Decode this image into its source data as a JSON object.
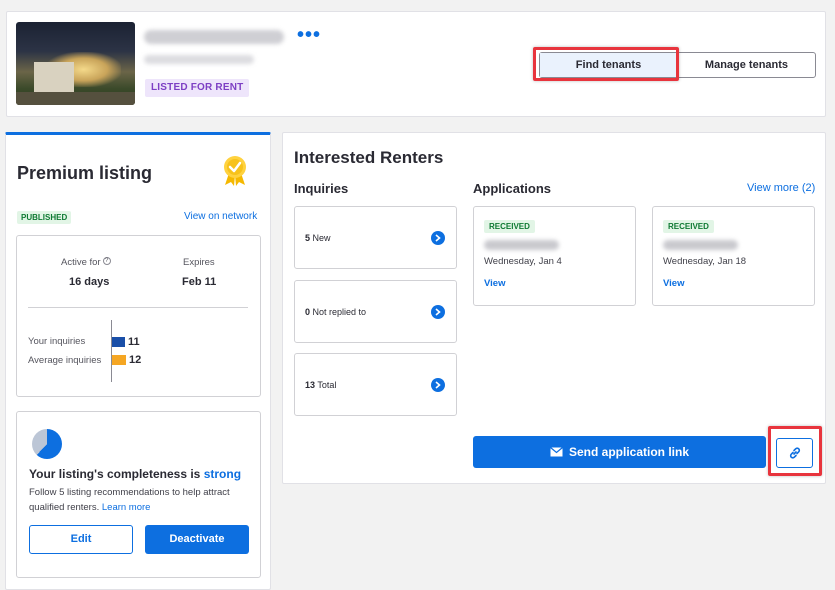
{
  "header": {
    "status_badge": "LISTED FOR RENT",
    "more_icon": "more-horizontal-icon",
    "tabs": [
      {
        "label": "Find tenants",
        "active": true
      },
      {
        "label": "Manage tenants",
        "active": false
      }
    ]
  },
  "premium": {
    "title": "Premium listing",
    "medal_icon": "medal-check-icon",
    "published_badge": "PUBLISHED",
    "view_network": "View on network",
    "active_for_label": "Active for",
    "active_for_value": "16 days",
    "expires_label": "Expires",
    "expires_value": "Feb 11",
    "inquiries": [
      {
        "label": "Your inquiries",
        "value": 11,
        "color": "#1a4fa8"
      },
      {
        "label": "Average inquiries",
        "value": 12,
        "color": "#f5a623"
      }
    ],
    "completeness": {
      "head_prefix": "Your listing's completeness is",
      "level": "strong",
      "fill": 0.62,
      "sub": "Follow 5 listing recommendations to help attract qualified renters.",
      "learn_more": "Learn more",
      "edit_label": "Edit",
      "deactivate_label": "Deactivate"
    }
  },
  "renters": {
    "title": "Interested Renters",
    "inquiries_title": "Inquiries",
    "inquiries": [
      {
        "count": "5",
        "label": "New"
      },
      {
        "count": "0",
        "label": "Not replied to"
      },
      {
        "count": "13",
        "label": "Total"
      }
    ],
    "applications_title": "Applications",
    "view_more": "View more (2)",
    "applications": [
      {
        "badge": "RECEIVED",
        "date": "Wednesday, Jan 4",
        "view": "View"
      },
      {
        "badge": "RECEIVED",
        "date": "Wednesday, Jan 18",
        "view": "View"
      }
    ],
    "send_link_label": "Send application link",
    "link_icon": "link-icon"
  },
  "colors": {
    "accent": "#0d6fe0",
    "highlight": "#e8343d"
  }
}
